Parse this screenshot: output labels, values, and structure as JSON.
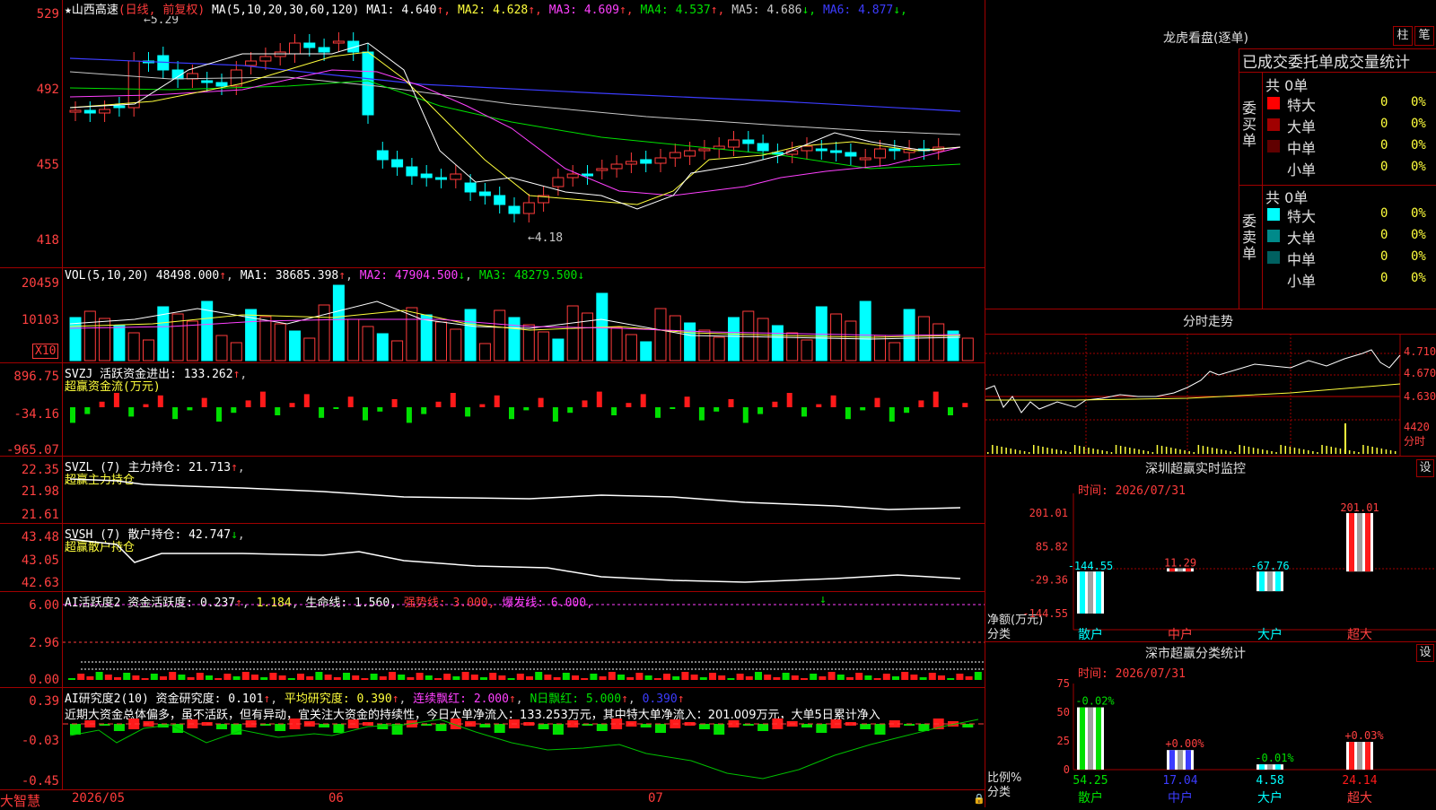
{
  "stock": {
    "name": "山西高速",
    "period": "(日线, 前复权)"
  },
  "ma_header": {
    "prefix": "MA(5,10,20,30,60,120)",
    "items": [
      {
        "label": "MA1: 4.640",
        "arrow": "↑",
        "color": "#ffffff"
      },
      {
        "label": "MA2: 4.628",
        "arrow": "↑",
        "color": "#ffff3c"
      },
      {
        "label": "MA3: 4.609",
        "arrow": "↑",
        "color": "#ff40ff"
      },
      {
        "label": "MA4: 4.537",
        "arrow": "↑",
        "color": "#00e000"
      },
      {
        "label": "MA5: 4.686",
        "arrow": "↓",
        "color": "#c8c8c8"
      },
      {
        "label": "MA6: 4.877",
        "arrow": "↓",
        "color": "#3c3cff"
      }
    ]
  },
  "price_axis": [
    "529",
    "492",
    "455",
    "418"
  ],
  "price_marks": {
    "high": "5.29",
    "low": "4.18"
  },
  "vol_header": {
    "prefix": "VOL(5,10,20)",
    "value": "48498.000",
    "ma1": "MA1: 38685.398",
    "ma2": "MA2: 47904.500",
    "ma3": "MA3: 48279.500"
  },
  "vol_axis": [
    "20459",
    "10103",
    "X10"
  ],
  "svzj": {
    "title": "SVZJ  活跃资金进出: 133.262",
    "subtitle": "超赢资金流(万元)",
    "axis": [
      "896.75",
      "-34.16",
      "-965.07"
    ]
  },
  "svzl": {
    "title": "SVZL (7) 主力持仓: 21.713",
    "subtitle": "超赢主力持仓",
    "axis": [
      "22.35",
      "21.98",
      "21.61"
    ]
  },
  "svsh": {
    "title": "SVSH (7) 散户持仓: 42.747",
    "subtitle": "超赢散户持仓",
    "axis": [
      "43.48",
      "43.05",
      "42.63"
    ]
  },
  "ai_active": {
    "title": "AI活跃度2 资金活跃度: 0.237",
    "v2": "1.184",
    "life": "生命线: 1.560,",
    "strong": "强势线: 3.000,",
    "burst": "爆发线: 6.000,",
    "axis": [
      "6.00",
      "2.96",
      "0.00"
    ]
  },
  "ai_research": {
    "title": "AI研究度2(10) 资金研究度: 0.101",
    "avg": "平均研究度: 0.390",
    "red": "连续飘红: 2.000",
    "nred": "N日飘红: 5.000",
    "v5": "0.390",
    "comment": "近期大资金总体偏多，虽不活跃，但有异动，宜关注大资金的持续性，今日大单净流入：133.253万元，其中特大单净流入：201.009万元，大单5日累计净入",
    "axis": [
      "0.39",
      "-0.03",
      "-0.45"
    ]
  },
  "date_axis": [
    "2026/05",
    "06",
    "07"
  ],
  "brand": "大智慧",
  "right": {
    "dragon_title": "龙虎看盘(逐单)",
    "btn_col": "柱",
    "btn_tick": "笔",
    "stats_title": "已成交委托单成交量统计",
    "buy_label": "委买单",
    "sell_label": "委卖单",
    "buy_total": "共 0单",
    "sell_total": "共 0单",
    "buy_rows": [
      {
        "name": "特大",
        "count": "0",
        "pct": "0%",
        "color": "#ff0000"
      },
      {
        "name": "大单",
        "count": "0",
        "pct": "0%",
        "color": "#a00000"
      },
      {
        "name": "中单",
        "count": "0",
        "pct": "0%",
        "color": "#600000"
      },
      {
        "name": "小单",
        "count": "0",
        "pct": "0%",
        "color": "#000000"
      }
    ],
    "sell_rows": [
      {
        "name": "特大",
        "count": "0",
        "pct": "0%",
        "color": "#00ffff"
      },
      {
        "name": "大单",
        "count": "0",
        "pct": "0%",
        "color": "#008a8a"
      },
      {
        "name": "中单",
        "count": "0",
        "pct": "0%",
        "color": "#006060"
      },
      {
        "name": "小单",
        "count": "0",
        "pct": "0%",
        "color": "#000000"
      }
    ],
    "intraday_title": "分时走势",
    "intraday_axis": [
      "4.710",
      "4.670",
      "4.630",
      "4420",
      "分时"
    ],
    "monitor_title": "深圳超赢实时监控",
    "set": "设",
    "time_label": "时间: 2026/07/31",
    "monitor_axis": [
      "201.01",
      "85.82",
      "-29.36",
      "-144.55"
    ],
    "net_label": "净额(万元)",
    "class_label": "分类",
    "monitor_bars": [
      {
        "name": "散户",
        "value": "-144.55"
      },
      {
        "name": "中户",
        "value": "11.29"
      },
      {
        "name": "大户",
        "value": "-67.76"
      },
      {
        "name": "超大",
        "value": "201.01"
      }
    ],
    "class_title": "深市超赢分类统计",
    "class_axis": [
      "75",
      "50",
      "25",
      "0"
    ],
    "ratio_label": "比例%",
    "class_bars": [
      {
        "name": "散户",
        "change": "-0.02%",
        "value": "54.25"
      },
      {
        "name": "中户",
        "change": "+0.00%",
        "value": "17.04"
      },
      {
        "name": "大户",
        "change": "-0.01%",
        "value": "4.58"
      },
      {
        "name": "超大",
        "change": "+0.03%",
        "value": "24.14"
      }
    ]
  }
}
